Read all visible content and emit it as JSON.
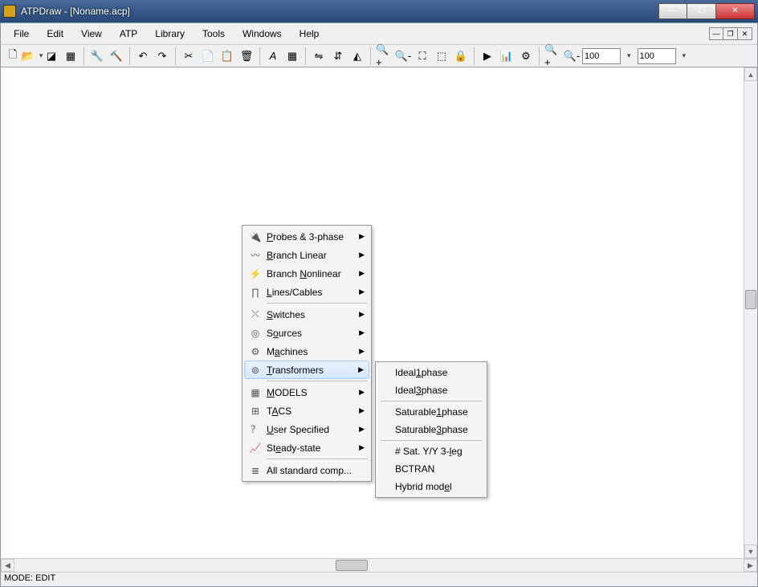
{
  "titlebar": {
    "text": "ATPDraw - [Noname.acp]"
  },
  "menubar": {
    "items": [
      "File",
      "Edit",
      "View",
      "ATP",
      "Library",
      "Tools",
      "Windows",
      "Help"
    ]
  },
  "toolbar": {
    "zoom1": "100",
    "zoom2": "100"
  },
  "statusbar": {
    "mode": "MODE: EDIT"
  },
  "context_menu": {
    "items": [
      {
        "icon": "🔌",
        "label_pre": "",
        "u": "P",
        "label_post": "robes & 3-phase",
        "arrow": true
      },
      {
        "icon": "〰",
        "label_pre": "",
        "u": "B",
        "label_post": "ranch Linear",
        "arrow": true
      },
      {
        "icon": "⚡",
        "label_pre": "Branch ",
        "u": "N",
        "label_post": "onlinear",
        "arrow": true
      },
      {
        "icon": "∏",
        "label_pre": "",
        "u": "L",
        "label_post": "ines/Cables",
        "arrow": true
      },
      {
        "sep": true
      },
      {
        "icon": "⤬",
        "label_pre": "",
        "u": "S",
        "label_post": "witches",
        "arrow": true
      },
      {
        "icon": "◎",
        "label_pre": "S",
        "u": "o",
        "label_post": "urces",
        "arrow": true
      },
      {
        "icon": "⚙",
        "label_pre": "M",
        "u": "a",
        "label_post": "chines",
        "arrow": true
      },
      {
        "icon": "⊚",
        "label_pre": "",
        "u": "T",
        "label_post": "ransformers",
        "arrow": true,
        "hover": true
      },
      {
        "sep": true
      },
      {
        "icon": "▦",
        "label_pre": "",
        "u": "M",
        "label_post": "ODELS",
        "arrow": true
      },
      {
        "icon": "⊞",
        "label_pre": "T",
        "u": "A",
        "label_post": "CS",
        "arrow": true
      },
      {
        "icon": "？",
        "label_pre": "",
        "u": "U",
        "label_post": "ser Specified",
        "arrow": true
      },
      {
        "icon": "📈",
        "label_pre": "St",
        "u": "e",
        "label_post": "ady-state",
        "arrow": true
      },
      {
        "sep": true
      },
      {
        "icon": "≣",
        "label_pre": "All standard comp...",
        "u": "",
        "label_post": "",
        "arrow": false
      }
    ]
  },
  "submenu": {
    "items": [
      {
        "label_pre": "Ideal ",
        "u": "1",
        "label_post": " phase"
      },
      {
        "label_pre": "Ideal ",
        "u": "3",
        "label_post": " phase"
      },
      {
        "sep": true
      },
      {
        "label_pre": "Saturable ",
        "u": "1",
        "label_post": " phase"
      },
      {
        "label_pre": "Saturable ",
        "u": "3",
        "label_post": " phase"
      },
      {
        "sep": true
      },
      {
        "label_pre": "# Sat. Y/Y 3-",
        "u": "l",
        "label_post": "eg"
      },
      {
        "label_pre": "BCTRAN",
        "u": "",
        "label_post": ""
      },
      {
        "label_pre": "Hybrid mod",
        "u": "e",
        "label_post": "l"
      }
    ]
  }
}
